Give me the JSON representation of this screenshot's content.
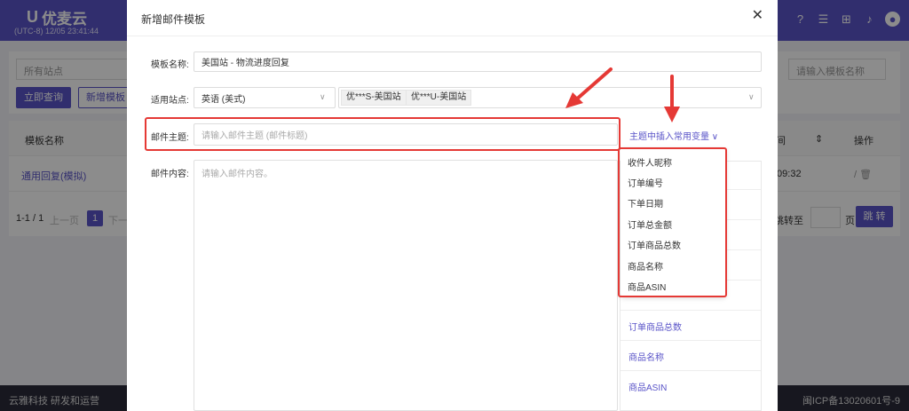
{
  "app": {
    "logo": "优麦云",
    "clock": "(UTC-8) 12/05 23:41:44"
  },
  "background": {
    "site_placeholder": "所有站点",
    "query_button": "立即查询",
    "add_button": "新增模板",
    "search_placeholder": "请输入模板名称",
    "table": {
      "col_name": "模板名称",
      "col_time": "间",
      "col_sort": "⇕",
      "col_action": "操作",
      "row_name": "通用回复(模拟)",
      "row_time": ":09:32",
      "row_action": "/ 🗑"
    },
    "pager": {
      "info": "1-1 / 1",
      "prev": "上一页",
      "page": "1",
      "next": "下一",
      "goto": "跳转至",
      "page_unit": "页",
      "jump": "跳 转"
    },
    "footer_left": "云雅科技 研发和运营",
    "footer_right": "闽ICP备13020601号-9"
  },
  "modal": {
    "title": "新增邮件模板",
    "close": "✕",
    "name_label": "模板名称:",
    "name_value": "美国站 - 物流进度回复",
    "site_label": "适用站点:",
    "language_value": "英语 (美式)",
    "site_tags": [
      "优***S-美国站",
      "优***U-美国站"
    ],
    "subject_label": "邮件主题:",
    "subject_placeholder": "请输入邮件主题 (邮件标题)",
    "insert_variable_label": "主题中插入常用变量 ∨",
    "content_label": "邮件内容:",
    "content_placeholder": "请输入邮件内容。",
    "dropdown_items": [
      "收件人昵称",
      "订单编号",
      "下单日期",
      "订单总金额",
      "订单商品总数",
      "商品名称",
      "商品ASIN"
    ],
    "side_list_items": [
      "",
      "",
      "",
      "",
      "",
      "订单商品总数",
      "商品名称",
      "商品ASIN"
    ]
  },
  "colors": {
    "brand": "#5a54c8",
    "highlight": "#e53935"
  }
}
